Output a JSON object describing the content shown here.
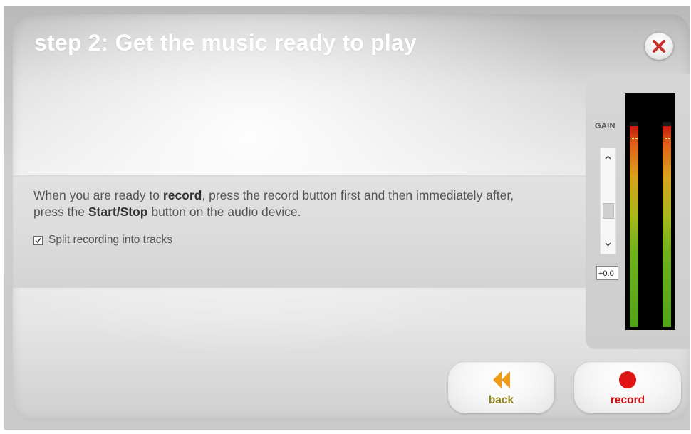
{
  "dialog": {
    "title": "step 2: Get the music ready to play"
  },
  "instructions": {
    "p1": "When you are ready to ",
    "b1": "record",
    "p2": ", press the record button first and then immediately after, press the ",
    "b2": "Start/Stop",
    "p3": " button on the audio device."
  },
  "options": {
    "split_label": "Split recording into tracks",
    "split_checked": true
  },
  "gain": {
    "label": "GAIN",
    "value": "+0.0",
    "slider_level": 0.3
  },
  "meters": {
    "left_level": 0.98,
    "right_level": 0.98
  },
  "buttons": {
    "back_label": "back",
    "record_label": "record"
  },
  "colors": {
    "back": "#8f8420",
    "back_icon": "#ee9a1a",
    "record": "#cc1111",
    "close": "#c8302a"
  }
}
